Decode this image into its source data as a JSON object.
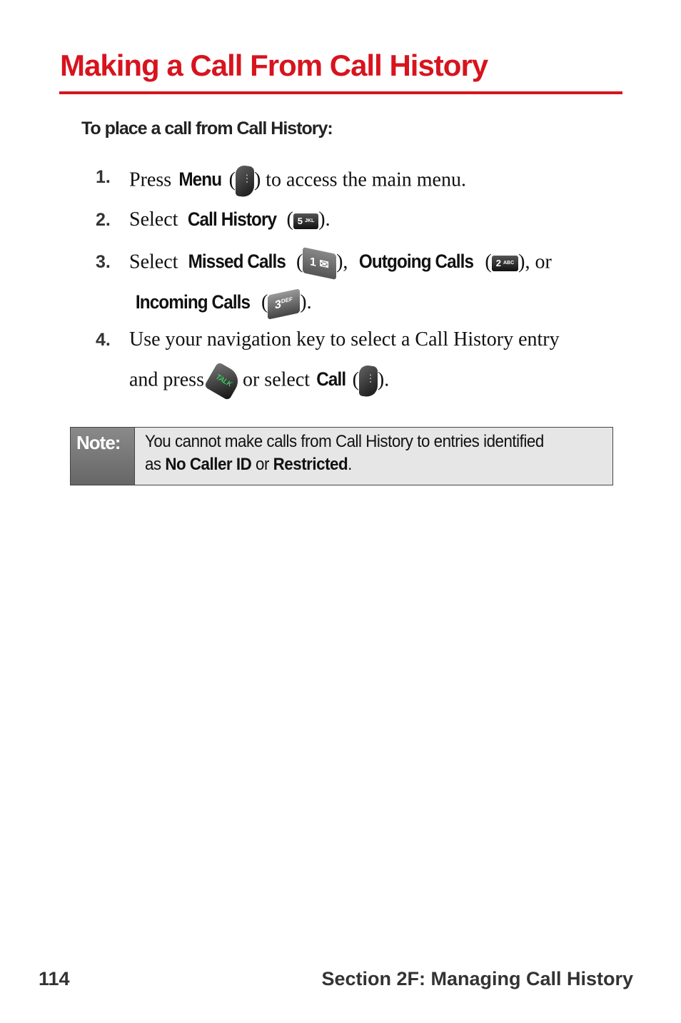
{
  "title": "Making a Call From Call History",
  "intro": "To place a call from Call History:",
  "steps": [
    {
      "num": "1.",
      "a": "Press ",
      "menu": "Menu",
      "b": " to access the main menu."
    },
    {
      "num": "2.",
      "a": "Select ",
      "call_history": "Call History"
    },
    {
      "num": "3.",
      "a": "Select ",
      "missed": "Missed Calls",
      "outgoing": "Outgoing Calls",
      "or": ", or",
      "incoming": "Incoming Calls"
    },
    {
      "num": "4.",
      "line1": "Use your navigation key to select a Call History entry",
      "a": "and press ",
      "b": " or select ",
      "call": "Call"
    }
  ],
  "keys": {
    "k5": "5",
    "k5sub": "JKL",
    "k1": "1",
    "k2": "2",
    "k2sub": "ABC",
    "k3": "3",
    "k3sub": "DEF",
    "talk": "TALK"
  },
  "note": {
    "label": "Note:",
    "line1": "You cannot make calls from Call History to entries identified",
    "as": "as ",
    "no_caller_id": "No Caller ID",
    "or": " or ",
    "restricted": "Restricted",
    "end": "."
  },
  "footer": {
    "page": "114",
    "section": "Section 2F: Managing Call History"
  },
  "colors": {
    "accent": "#d7141e"
  }
}
